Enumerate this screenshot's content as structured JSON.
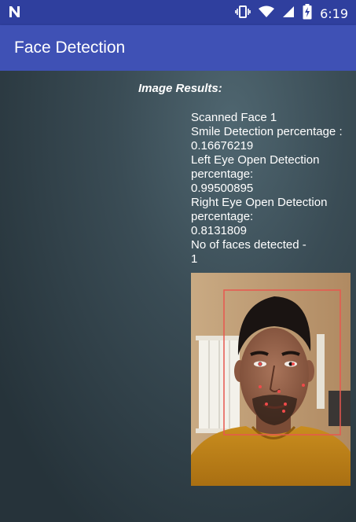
{
  "status_bar": {
    "time": "6:19",
    "left_icon": "n-icon",
    "icons": [
      "vibrate-icon",
      "wifi-icon",
      "signal-icon",
      "battery-charging-icon"
    ]
  },
  "app_bar": {
    "title": "Face Detection"
  },
  "main": {
    "results_heading": "Image Results:",
    "results_lines": [
      "Scanned Face 1",
      "Smile Detection percentage :",
      "0.16676219",
      "Left Eye Open Detection percentage:",
      "0.99500895",
      "Right Eye Open Detection percentage:",
      "0.8131809",
      "No of faces detected -",
      "1"
    ]
  },
  "colors": {
    "status_bar": "#2f3f9e",
    "app_bar": "#3f51b5",
    "face_box": "#e8574f",
    "landmark": "#f04a4a"
  }
}
